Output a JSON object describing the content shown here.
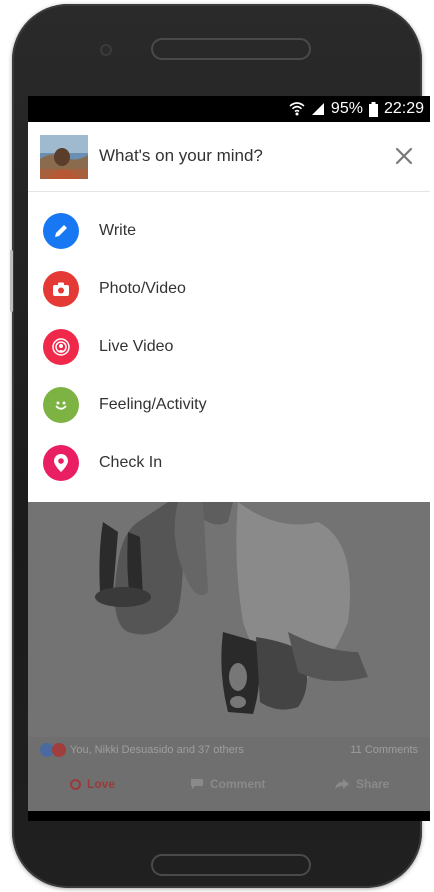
{
  "status": {
    "battery": "95%",
    "time": "22:29"
  },
  "composer": {
    "prompt": "What's on your mind?"
  },
  "menu": {
    "items": [
      {
        "label": "Write",
        "icon": "pencil-icon",
        "color": "#1877f2"
      },
      {
        "label": "Photo/Video",
        "icon": "camera-icon",
        "color": "#e53935"
      },
      {
        "label": "Live Video",
        "icon": "live-video-icon",
        "color": "#f02849"
      },
      {
        "label": "Feeling/Activity",
        "icon": "smiley-icon",
        "color": "#7cb342"
      },
      {
        "label": "Check In",
        "icon": "location-pin-icon",
        "color": "#e91e63"
      }
    ]
  },
  "feed": {
    "reactions_text": "You, Nikki Desuasido and 37 others",
    "comments_text": "11 Comments",
    "actions": [
      {
        "label": "Love"
      },
      {
        "label": "Comment"
      },
      {
        "label": "Share"
      }
    ]
  }
}
